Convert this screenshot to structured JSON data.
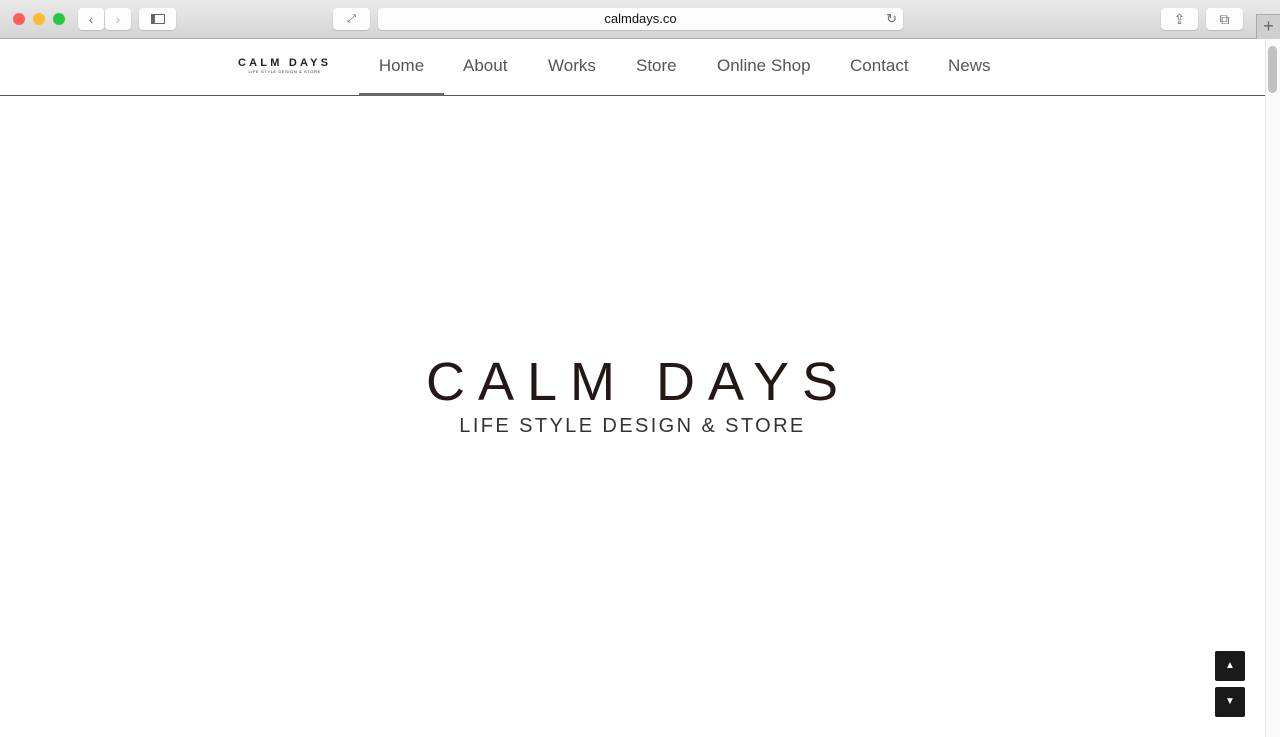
{
  "browser": {
    "url": "calmdays.co"
  },
  "nav": {
    "logo_title": "CALM DAYS",
    "logo_subtitle": "LIFE STYLE DESIGN & STORE",
    "items": [
      {
        "label": "Home",
        "active": true
      },
      {
        "label": "About"
      },
      {
        "label": "Works"
      },
      {
        "label": "Store"
      },
      {
        "label": "Online Shop"
      },
      {
        "label": "Contact"
      },
      {
        "label": "News"
      }
    ]
  },
  "hero": {
    "title": "CALM DAYS",
    "subtitle": "LIFE STYLE DESIGN & STORE"
  },
  "scroll": {
    "up": "▲",
    "down": "▼"
  }
}
